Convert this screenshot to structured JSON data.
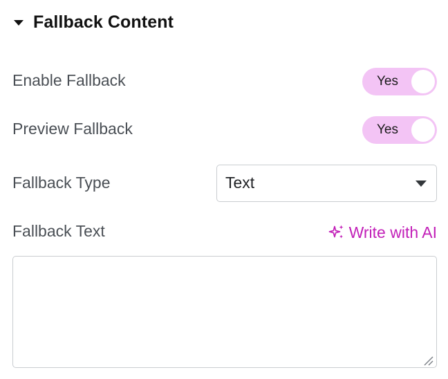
{
  "section": {
    "title": "Fallback Content",
    "icon": "caret-down-icon"
  },
  "enable_fallback": {
    "label": "Enable Fallback",
    "toggle_label": "Yes",
    "enabled": true
  },
  "preview_fallback": {
    "label": "Preview Fallback",
    "toggle_label": "Yes",
    "enabled": true
  },
  "fallback_type": {
    "label": "Fallback Type",
    "selected": "Text",
    "icon": "chevron-down-icon"
  },
  "fallback_text": {
    "label": "Fallback Text",
    "ai_link_label": "Write with AI",
    "ai_icon": "sparkle-icon",
    "value": "",
    "placeholder": ""
  },
  "colors": {
    "toggle_on": "#f3c4f5",
    "ai_accent": "#c21fb8",
    "label_text": "#4a4f55",
    "border": "#c9ccd0"
  }
}
